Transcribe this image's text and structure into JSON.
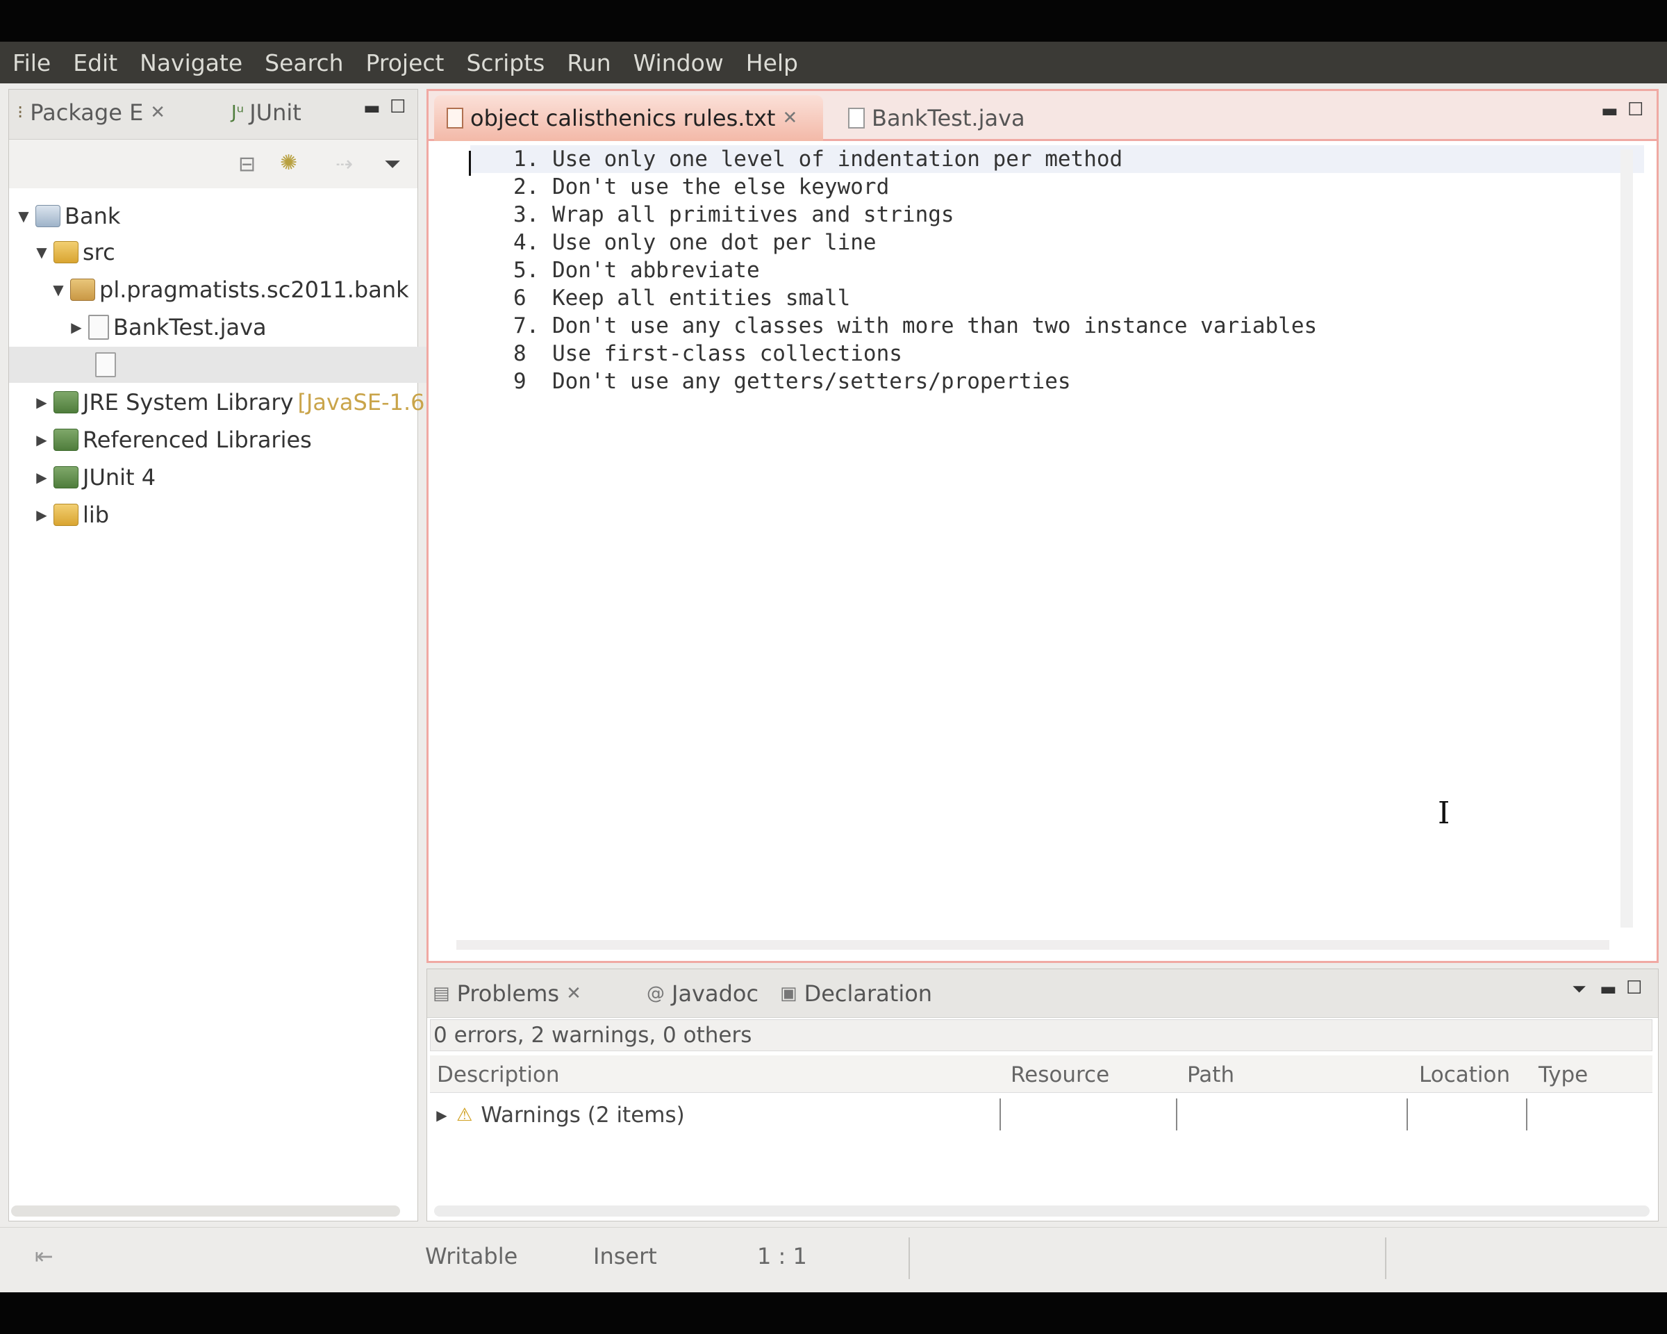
{
  "menu": [
    "File",
    "Edit",
    "Navigate",
    "Search",
    "Project",
    "Scripts",
    "Run",
    "Window",
    "Help"
  ],
  "left_panel": {
    "tabs": [
      "Package E",
      "JUnit"
    ],
    "tree": {
      "project": "Bank",
      "src": "src",
      "package": "pl.pragmatists.sc2011.bank",
      "file": "BankTest.java",
      "jre": "JRE System Library",
      "jre_suffix": "[JavaSE-1.6",
      "referenced": "Referenced Libraries",
      "junit": "JUnit 4",
      "lib": "lib"
    }
  },
  "editor": {
    "active_tab": "object calisthenics rules.txt",
    "inactive_tab": "BankTest.java",
    "lines": [
      "1. Use only one level of indentation per method",
      "2. Don't use the else keyword",
      "3. Wrap all primitives and strings",
      "4. Use only one dot per line",
      "5. Don't abbreviate",
      "6  Keep all entities small",
      "7. Don't use any classes with more than two instance variables",
      "8  Use first-class collections",
      "9  Don't use any getters/setters/properties"
    ]
  },
  "problems": {
    "tabs": [
      "Problems",
      "Javadoc",
      "Declaration"
    ],
    "summary": "0 errors, 2 warnings, 0 others",
    "columns": [
      "Description",
      "Resource",
      "Path",
      "Location",
      "Type"
    ],
    "row": "Warnings (2 items)"
  },
  "status": {
    "writable": "Writable",
    "insert": "Insert",
    "position": "1 : 1"
  },
  "colors": {
    "menubar": "#3b3a36",
    "editor_border": "#f0a9a3",
    "active_tab": "#f3b9a8"
  }
}
